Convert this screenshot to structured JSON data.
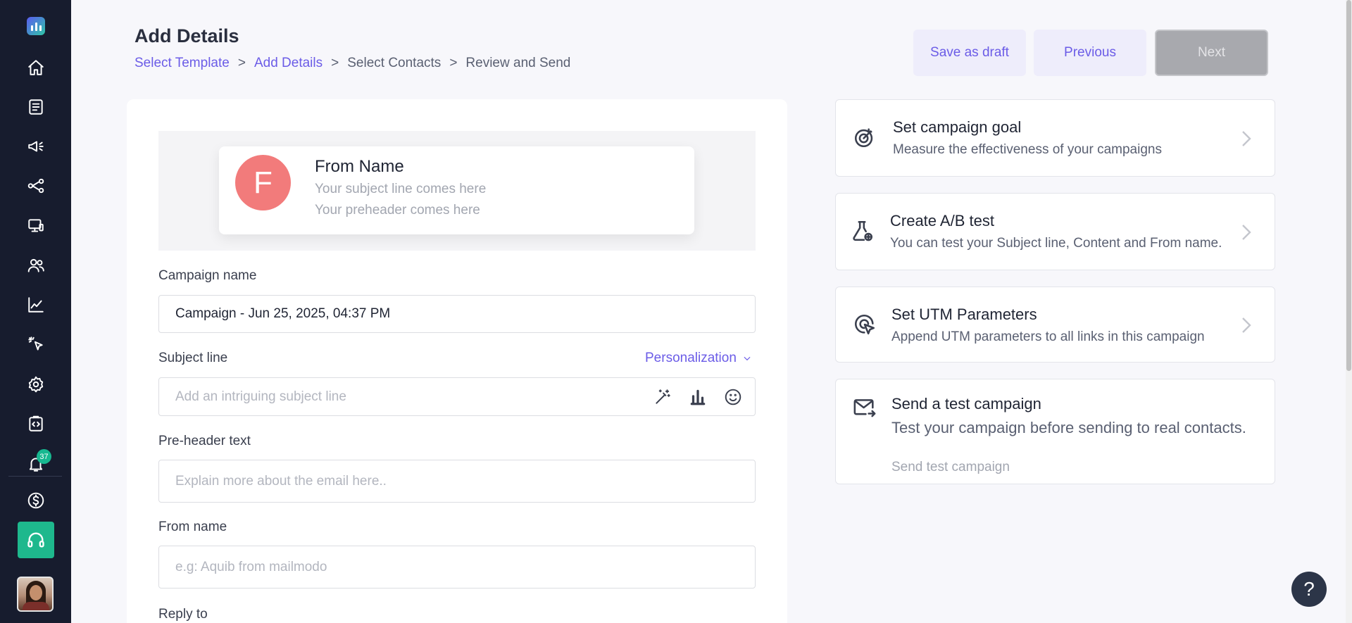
{
  "sidebar": {
    "items": [
      {
        "name": "home-icon"
      },
      {
        "name": "document-icon"
      },
      {
        "name": "megaphone-icon"
      },
      {
        "name": "journey-icon"
      },
      {
        "name": "screen-icon"
      },
      {
        "name": "contacts-icon"
      },
      {
        "name": "analytics-icon"
      },
      {
        "name": "pointer-icon"
      },
      {
        "name": "settings-icon"
      },
      {
        "name": "code-icon"
      },
      {
        "name": "bell-icon"
      }
    ],
    "notification_count": "37",
    "billing_icon": "dollar-icon",
    "support_icon": "headphones-icon"
  },
  "header": {
    "title": "Add Details",
    "breadcrumb": [
      {
        "label": "Select Template",
        "active": true
      },
      {
        "label": "Add Details",
        "active": true
      },
      {
        "label": "Select Contacts",
        "active": false
      },
      {
        "label": "Review and Send",
        "active": false
      }
    ],
    "breadcrumb_separator": ">",
    "save_draft_label": "Save as draft",
    "previous_label": "Previous",
    "next_label": "Next"
  },
  "preview": {
    "avatar_letter": "F",
    "from_name": "From Name",
    "subject": "Your subject line comes here",
    "preheader": "Your preheader comes here"
  },
  "form": {
    "campaign_name_label": "Campaign name",
    "campaign_name_value": "Campaign - Jun 25, 2025, 04:37 PM",
    "subject_label": "Subject line",
    "personalization_label": "Personalization",
    "subject_placeholder": "Add an intriguing subject line",
    "preheader_label": "Pre-header text",
    "preheader_placeholder": "Explain more about the email here..",
    "from_name_label": "From name",
    "from_name_placeholder": "e.g: Aquib from mailmodo",
    "reply_to_label": "Reply to"
  },
  "side_cards": {
    "goal": {
      "title": "Set campaign goal",
      "desc": "Measure the effectiveness of your campaigns"
    },
    "ab": {
      "title": "Create A/B test",
      "desc": "You can test your Subject line, Content and From name."
    },
    "utm": {
      "title": "Set UTM Parameters",
      "desc": "Append UTM parameters to all links in this campaign"
    },
    "test": {
      "title": "Send a test campaign",
      "desc": "Test your campaign before sending to real contacts.",
      "link": "Send test campaign"
    }
  },
  "help": {
    "label": "?"
  },
  "colors": {
    "accent": "#6b5ce7",
    "sidebar_bg": "#171c2e",
    "support_green": "#1eb88d",
    "avatar_red": "#f27b7b"
  }
}
